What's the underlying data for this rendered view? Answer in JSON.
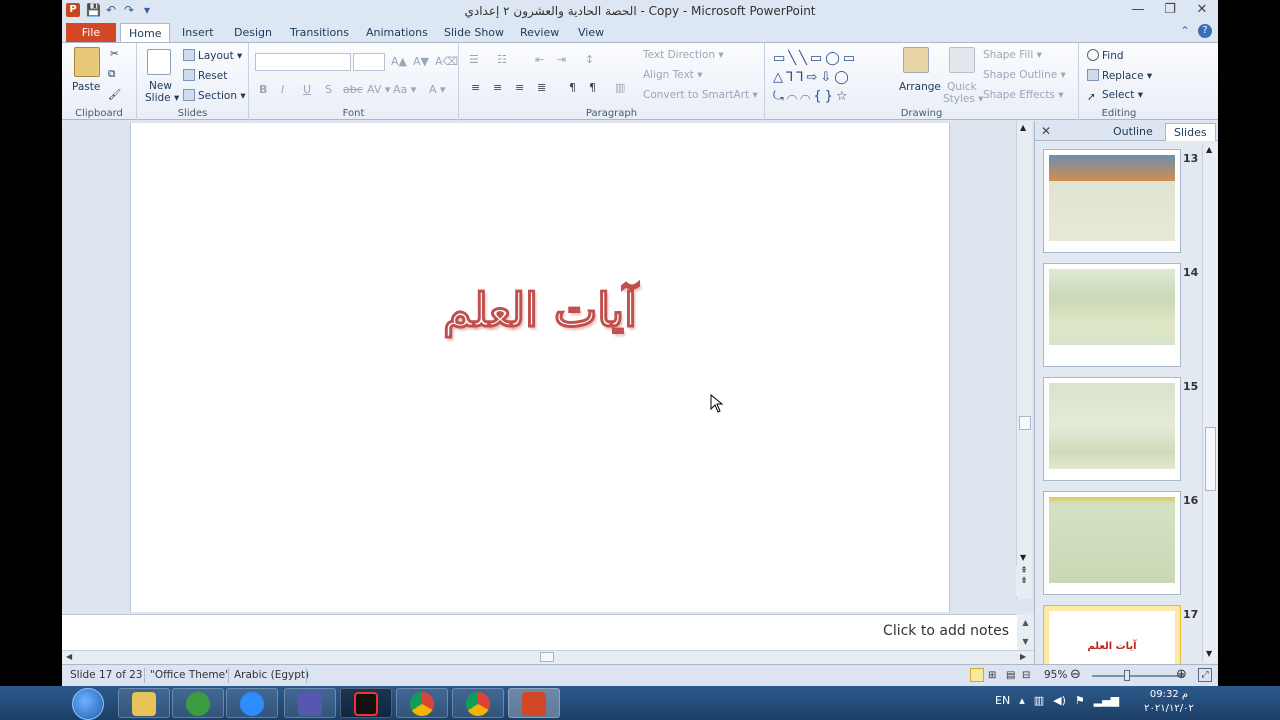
{
  "window": {
    "title": "الحصة الحادية والعشرون ٢ إعدادي - Copy - Microsoft PowerPoint"
  },
  "qat": {
    "save": "💾",
    "undo": "↶",
    "redo": "↷",
    "customize": "▾"
  },
  "window_controls": {
    "minimize": "—",
    "restore": "❐",
    "close": "✕"
  },
  "tabs": [
    {
      "label": "File"
    },
    {
      "label": "Home"
    },
    {
      "label": "Insert"
    },
    {
      "label": "Design"
    },
    {
      "label": "Transitions"
    },
    {
      "label": "Animations"
    },
    {
      "label": "Slide Show"
    },
    {
      "label": "Review"
    },
    {
      "label": "View"
    }
  ],
  "ribbon_right": {
    "minimize": "⌃",
    "help": "?"
  },
  "ribbon": {
    "clipboard": {
      "label": "Clipboard",
      "paste": "Paste",
      "cut": "✂",
      "copy": "⧉",
      "format_painter": "🖌"
    },
    "slides": {
      "label": "Slides",
      "new_slide_1": "New",
      "new_slide_2": "Slide ▾",
      "layout": "Layout ▾",
      "reset": "Reset",
      "section": "Section ▾"
    },
    "font": {
      "label": "Font",
      "bold": "B",
      "italic": "I",
      "underline": "U",
      "shadow": "S",
      "strike": "abc",
      "spacing": "AV ▾",
      "case": "Aa ▾",
      "color": "A ▾",
      "grow": "A▲",
      "shrink": "A▼",
      "clear": "A⌫"
    },
    "paragraph": {
      "label": "Paragraph",
      "text_direction": "Text Direction ▾",
      "align_text": "Align Text ▾",
      "convert_smartart": "Convert to SmartArt ▾"
    },
    "drawing": {
      "label": "Drawing",
      "arrange": "Arrange",
      "quick_styles_1": "Quick",
      "quick_styles_2": "Styles ▾",
      "shape_fill": "Shape Fill ▾",
      "shape_outline": "Shape Outline ▾",
      "shape_effects": "Shape Effects ▾",
      "shapes": "▭╲╲▭◯▭ △⅂⅂⇨⇩◯ ⤿⌒⌒{}☆"
    },
    "editing": {
      "label": "Editing",
      "find": "Find",
      "replace": "Replace ▾",
      "select": "Select ▾"
    }
  },
  "slide": {
    "title": "آيات العلم"
  },
  "notes": {
    "placeholder": "Click to add notes"
  },
  "pane": {
    "close": "✕",
    "tab_outline": "Outline",
    "tab_slides": "Slides",
    "thumbs": [
      {
        "num": "13"
      },
      {
        "num": "14"
      },
      {
        "num": "15"
      },
      {
        "num": "16"
      },
      {
        "num": "17",
        "text": "آيات العلم"
      }
    ]
  },
  "status": {
    "slide_info": "Slide 17 of 23",
    "theme": "\"Office Theme\"",
    "language": "Arabic (Egypt)",
    "zoom": "95%",
    "zoom_out": "⊖",
    "zoom_in": "⊕"
  },
  "taskbar": {
    "lang": "EN",
    "time": "09:32 م",
    "date": "٢٠٢١/١٢/٠٢"
  }
}
